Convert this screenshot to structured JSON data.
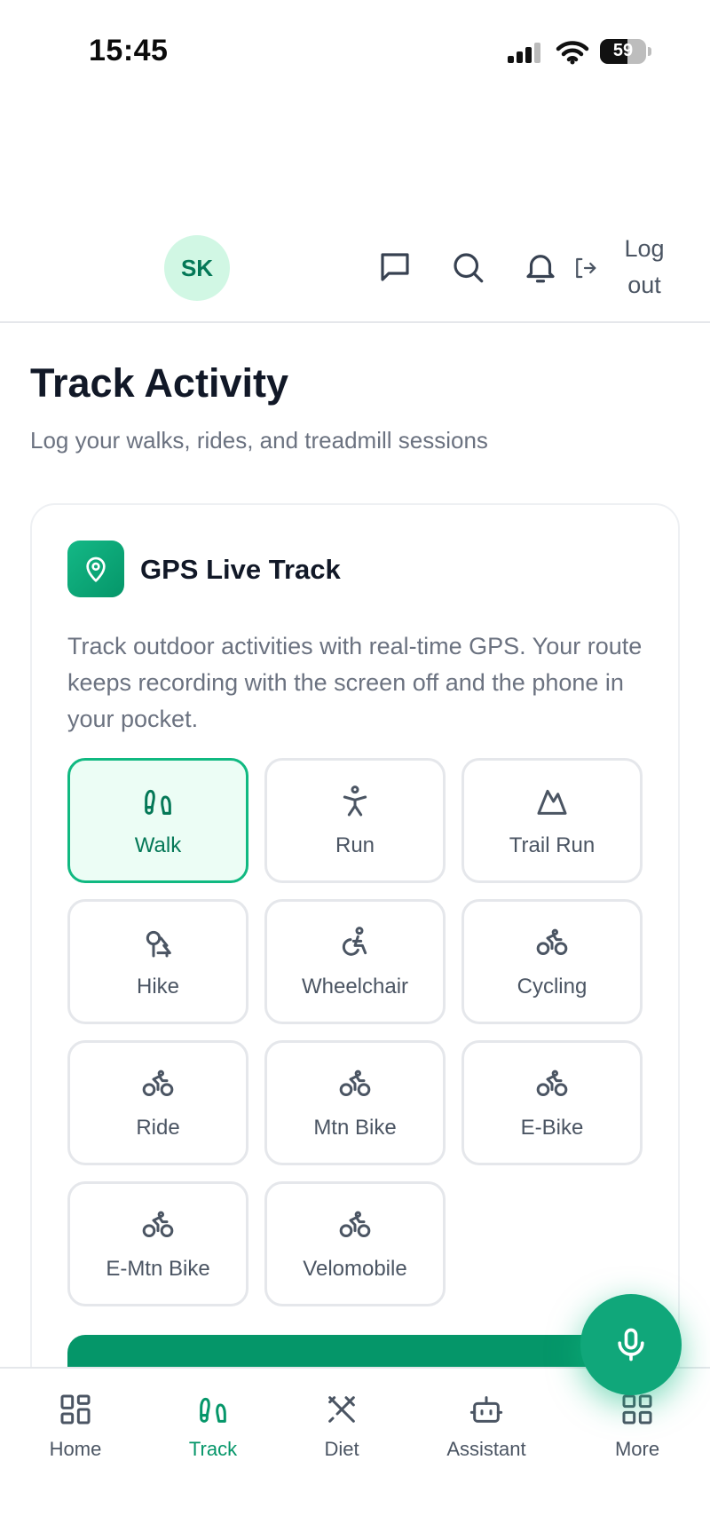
{
  "status_bar": {
    "time": "15:45",
    "battery": "59"
  },
  "header": {
    "avatar_initials": "SK",
    "logout_label": "Log out"
  },
  "page": {
    "title": "Track Activity",
    "subtitle": "Log your walks, rides, and treadmill sessions"
  },
  "gps_card": {
    "title": "GPS Live Track",
    "description": "Track outdoor activities with real-time GPS. Your route keeps recording with the screen off and the phone in your pocket.",
    "activities": [
      {
        "label": "Walk",
        "icon": "footprints-icon",
        "selected": true
      },
      {
        "label": "Run",
        "icon": "running-person-icon",
        "selected": false
      },
      {
        "label": "Trail Run",
        "icon": "mountain-icon",
        "selected": false
      },
      {
        "label": "Hike",
        "icon": "trees-icon",
        "selected": false
      },
      {
        "label": "Wheelchair",
        "icon": "wheelchair-icon",
        "selected": false
      },
      {
        "label": "Cycling",
        "icon": "bike-icon",
        "selected": false
      },
      {
        "label": "Ride",
        "icon": "bike-icon",
        "selected": false
      },
      {
        "label": "Mtn Bike",
        "icon": "bike-icon",
        "selected": false
      },
      {
        "label": "E-Bike",
        "icon": "bike-icon",
        "selected": false
      },
      {
        "label": "E-Mtn Bike",
        "icon": "bike-icon",
        "selected": false
      },
      {
        "label": "Velomobile",
        "icon": "bike-icon",
        "selected": false
      }
    ]
  },
  "bottom_nav": [
    {
      "label": "Home",
      "icon": "grid-icon",
      "active": false
    },
    {
      "label": "Track",
      "icon": "footprints-icon",
      "active": true
    },
    {
      "label": "Diet",
      "icon": "utensils-icon",
      "active": false
    },
    {
      "label": "Assistant",
      "icon": "bot-icon",
      "active": false
    },
    {
      "label": "More",
      "icon": "grid-icon",
      "active": false
    }
  ],
  "colors": {
    "accent": "#059669",
    "accent_light": "#ecfdf5",
    "avatar_bg": "#d1f7e4",
    "text_primary": "#111827",
    "text_muted": "#6b7280"
  }
}
